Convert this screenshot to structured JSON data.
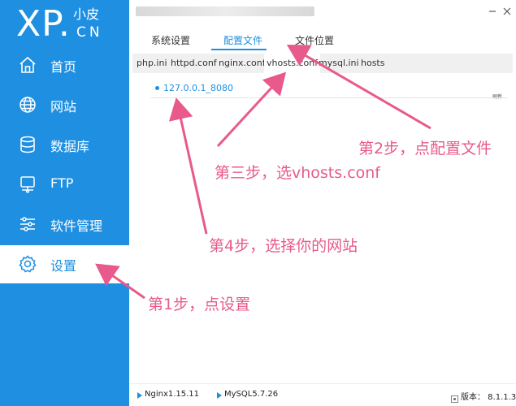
{
  "logo": {
    "main": "XP.",
    "sub": "小皮",
    "cn": "CN"
  },
  "sidebar": {
    "items": [
      {
        "label": "首页",
        "icon": "home-icon"
      },
      {
        "label": "网站",
        "icon": "globe-icon"
      },
      {
        "label": "数据库",
        "icon": "database-icon"
      },
      {
        "label": "FTP",
        "icon": "ftp-server-icon"
      },
      {
        "label": "软件管理",
        "icon": "sliders-icon"
      },
      {
        "label": "设置",
        "icon": "gear-icon",
        "active": true
      }
    ]
  },
  "window": {
    "minimize_icon": "minimize-icon",
    "close_icon": "close-icon"
  },
  "tabs": [
    {
      "label": "系统设置"
    },
    {
      "label": "配置文件",
      "active": true
    },
    {
      "label": "文件位置"
    }
  ],
  "subtabs": [
    {
      "label": "php.ini"
    },
    {
      "label": "httpd.conf"
    },
    {
      "label": "nginx.conf"
    },
    {
      "label": "vhosts.conf",
      "active": true
    },
    {
      "label": "mysql.ini"
    },
    {
      "label": "hosts"
    }
  ],
  "content": {
    "site": "127.0.0.1_8080",
    "refresh": "刷新"
  },
  "statusbar": {
    "nginx": "Nginx1.15.11",
    "mysql": "MySQL5.7.26",
    "version": "版本： 8.1.1.3"
  },
  "annotations": {
    "step1": "第1步，点设置",
    "step2": "第2步，点配置文件",
    "step3": "第三步，选vhosts.conf",
    "step4": "第4步，选择你的网站"
  },
  "colors": {
    "accent": "#1e8fe1",
    "annotation": "#e8598c"
  }
}
